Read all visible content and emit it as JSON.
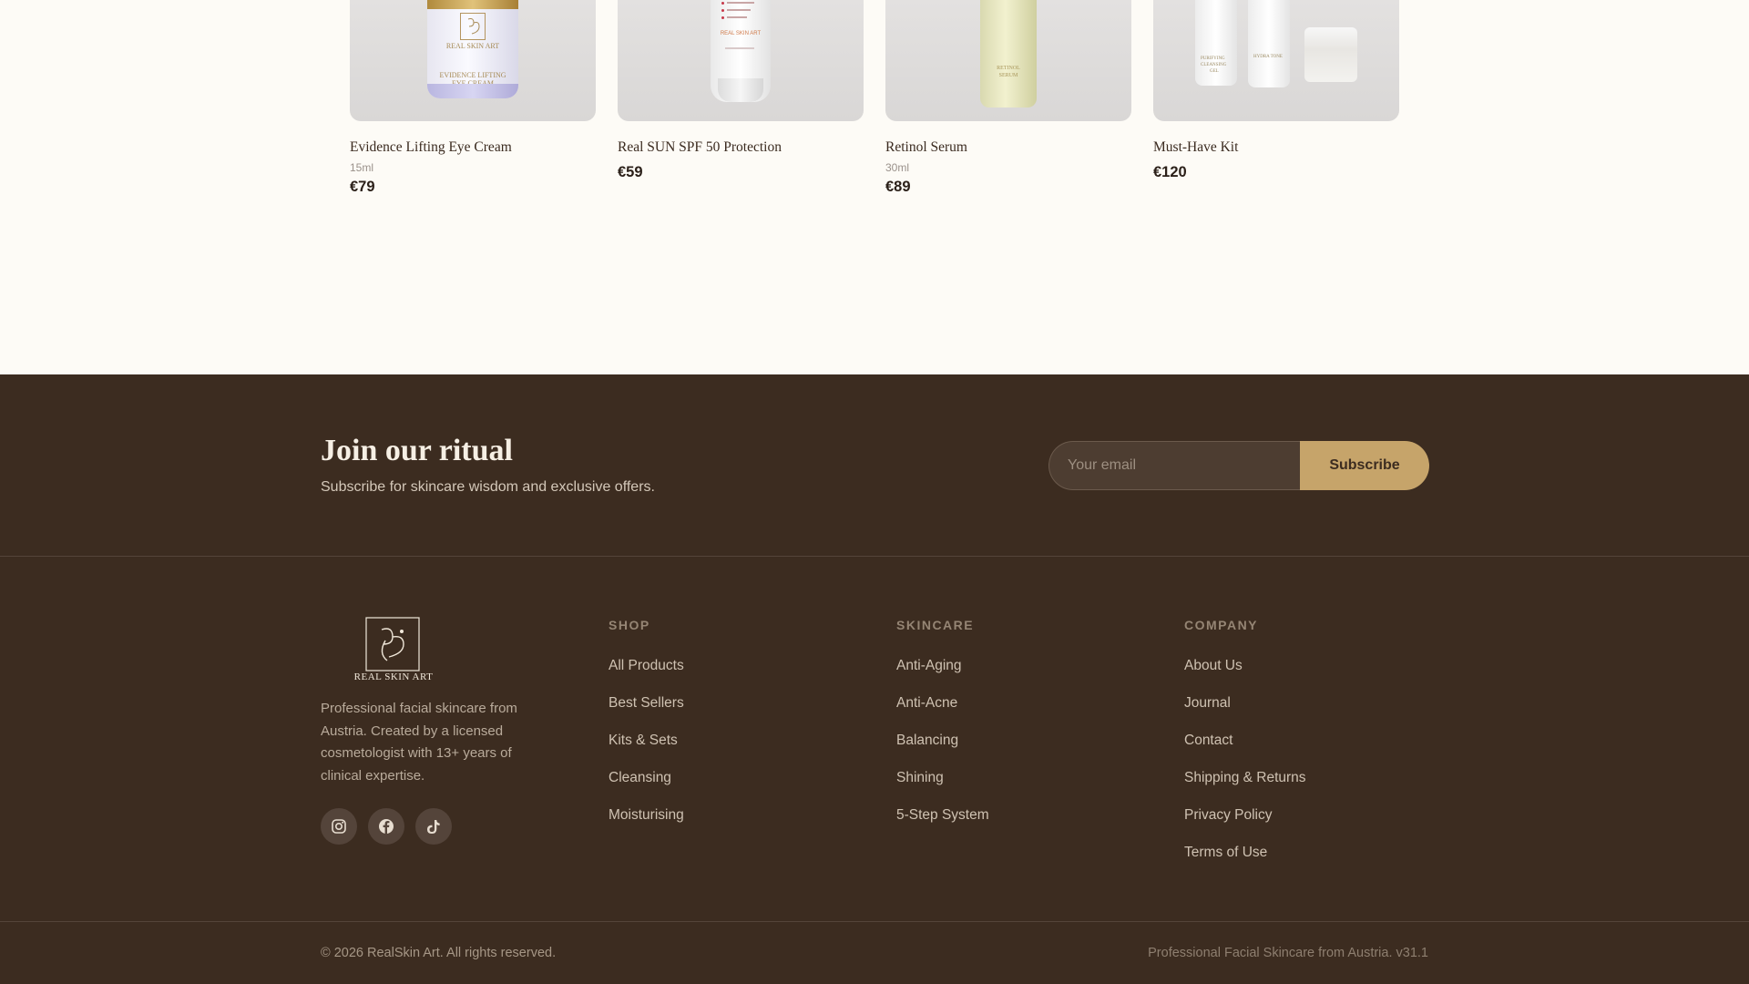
{
  "products": [
    {
      "name": "Evidence Lifting Eye Cream",
      "size": "15ml",
      "price": "€79",
      "image_text": [
        "REAL SKIN ART",
        "EVIDENCE LIFTING",
        "EYE CREAM"
      ]
    },
    {
      "name": "Real SUN SPF 50 Protection",
      "price": "€59",
      "image_text": [
        "REAL SKIN ART"
      ]
    },
    {
      "name": "Retinol Serum",
      "size": "30ml",
      "price": "€89",
      "image_text": [
        "RETINOL",
        "SERUM"
      ]
    },
    {
      "name": "Must-Have Kit",
      "price": "€120",
      "image_text": [
        "PURIFYING",
        "CLEANSING",
        "GEL",
        "HYDRA TONE"
      ]
    }
  ],
  "newsletter": {
    "title": "Join our ritual",
    "subtitle": "Subscribe for skincare wisdom and exclusive offers.",
    "email_placeholder": "Your email",
    "subscribe_label": "Subscribe"
  },
  "footer": {
    "logo_text": "REAL SKIN ART",
    "about": "Professional facial skincare from Austria. Created by a licensed cosmetologist with 13+ years of clinical expertise.",
    "socials": [
      {
        "icon": "instagram-icon"
      },
      {
        "icon": "facebook-icon"
      },
      {
        "icon": "tiktok-icon"
      }
    ],
    "columns": [
      {
        "heading": "SHOP",
        "links": [
          "All Products",
          "Best Sellers",
          "Kits & Sets",
          "Cleansing",
          "Moisturising"
        ]
      },
      {
        "heading": "SKINCARE",
        "links": [
          "Anti-Aging",
          "Anti-Acne",
          "Balancing",
          "Shining",
          "5-Step System"
        ]
      },
      {
        "heading": "COMPANY",
        "links": [
          "About Us",
          "Journal",
          "Contact",
          "Shipping & Returns",
          "Privacy Policy",
          "Terms of Use"
        ]
      }
    ],
    "copyright": "© 2026 RealSkin Art. All rights reserved.",
    "tagline": "Professional Facial Skincare from Austria. v31.1"
  },
  "colors": {
    "page_bg": "#fdfbf6",
    "footer_bg": "#3c2c20",
    "accent_gold": "#c6a46a",
    "text_dark": "#2b2019"
  }
}
